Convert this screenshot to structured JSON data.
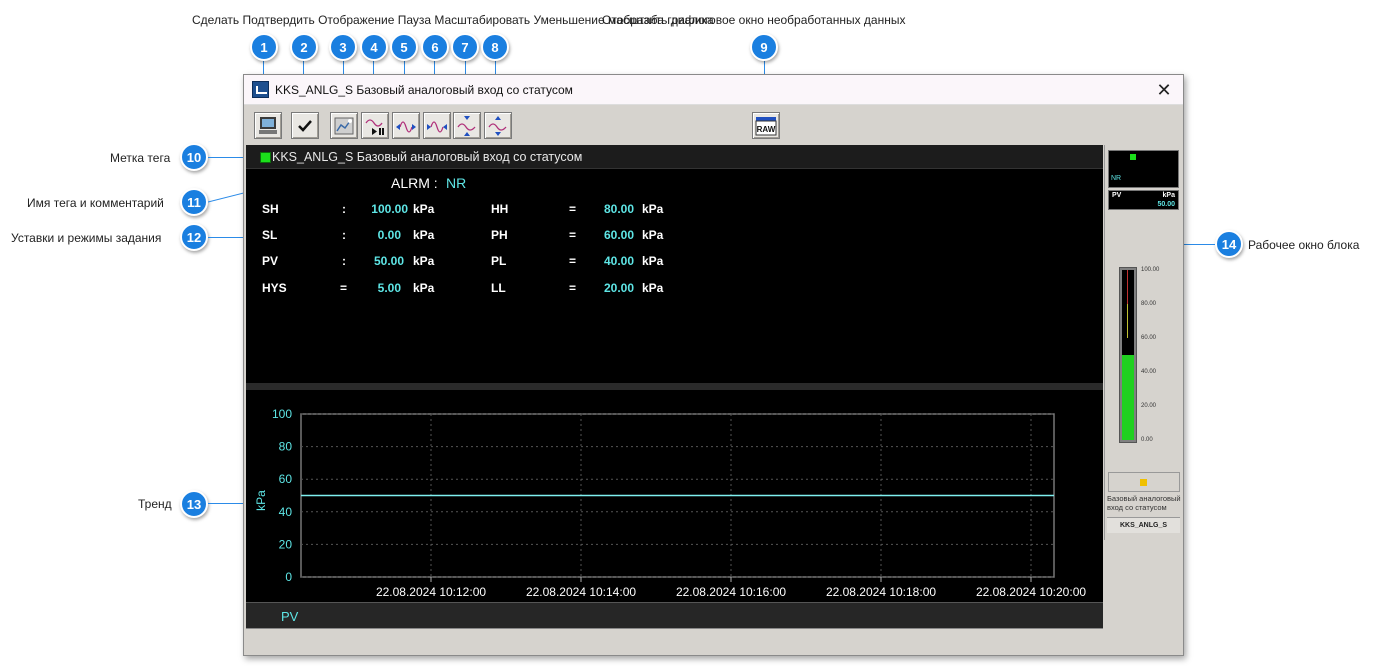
{
  "window": {
    "title": "KKS_ANLG_S Базовый аналоговый вход со статусом",
    "close_glyph": "✕"
  },
  "toolbar": {
    "buttons": [
      {
        "id": 1,
        "icon": "computer-icon"
      },
      {
        "id": 2,
        "icon": "checkmark-icon"
      },
      {
        "id": 3,
        "icon": "chart-edit-icon"
      },
      {
        "id": 4,
        "icon": "trend-pause-icon"
      },
      {
        "id": 5,
        "icon": "trend-zoom-in-horizontal-icon"
      },
      {
        "id": 6,
        "icon": "trend-zoom-out-horizontal-icon"
      },
      {
        "id": 7,
        "icon": "trend-zoom-in-vertical-icon"
      },
      {
        "id": 8,
        "icon": "trend-zoom-out-vertical-icon"
      },
      {
        "id": 9,
        "icon": "raw-data-icon",
        "label": "RAW"
      }
    ]
  },
  "annotations": {
    "top_overlap_text": "Сделать Подтвердить Отображение Пауза Масштабировать Уменьшение масштаба графика",
    "raw_text": "Отобразить диалоговое окно необработанных данных",
    "tag_mark": "Метка тега",
    "tag_name_comment": "Имя тега и комментарий",
    "setpoints": "Уставки и режимы задания",
    "trend": "Тренд",
    "block_window": "Рабочее окно блока",
    "numbers": [
      "1",
      "2",
      "3",
      "4",
      "5",
      "6",
      "7",
      "8",
      "9",
      "10",
      "11",
      "12",
      "13",
      "14"
    ]
  },
  "tag": {
    "name": "KKS_ANLG_S Базовый аналоговый вход со статусом",
    "marker_color": "#1be01b"
  },
  "params": {
    "alrm_label": "ALRM :",
    "alrm_value": "NR",
    "left": [
      {
        "name": "SH",
        "sep": ":",
        "value": "100.00",
        "unit": "kPa"
      },
      {
        "name": "SL",
        "sep": ":",
        "value": "0.00",
        "unit": "kPa"
      },
      {
        "name": "PV",
        "sep": ":",
        "value": "50.00",
        "unit": "kPa"
      },
      {
        "name": "HYS",
        "sep": "=",
        "value": "5.00",
        "unit": "kPa"
      }
    ],
    "right": [
      {
        "name": "HH",
        "sep": "=",
        "value": "80.00",
        "unit": "kPa"
      },
      {
        "name": "PH",
        "sep": "=",
        "value": "60.00",
        "unit": "kPa"
      },
      {
        "name": "PL",
        "sep": "=",
        "value": "40.00",
        "unit": "kPa"
      },
      {
        "name": "LL",
        "sep": "=",
        "value": "20.00",
        "unit": "kPa"
      }
    ]
  },
  "trend": {
    "ylabel": "kPa",
    "y_ticks": [
      "100",
      "80",
      "60",
      "40",
      "20",
      "0"
    ],
    "x_ticks": [
      "22.08.2024 10:12:00",
      "22.08.2024 10:14:00",
      "22.08.2024 10:16:00",
      "22.08.2024 10:18:00",
      "22.08.2024 10:20:00"
    ],
    "legend_pv": "PV",
    "pv_value": 50,
    "y_range": [
      0,
      100
    ],
    "line_color": "#7ff0f0"
  },
  "faceplate": {
    "alarm": "NR",
    "pv_label": "PV",
    "unit": "kPa",
    "pv_value": "50.00",
    "pv_fraction": 0.5,
    "scale": [
      "100.00",
      "80.00",
      "60.00",
      "40.00",
      "20.00",
      "0.00"
    ],
    "description": "Базовый аналоговый вход со статусом",
    "tag": "KKS_ANLG_S"
  }
}
